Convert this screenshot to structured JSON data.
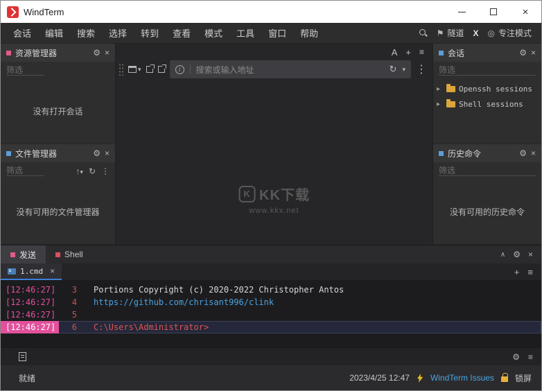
{
  "window": {
    "title": "WindTerm"
  },
  "menubar": {
    "items": [
      "会话",
      "编辑",
      "搜索",
      "选择",
      "转到",
      "查看",
      "模式",
      "工具",
      "窗口",
      "帮助"
    ],
    "tunnel_label": "隧道",
    "x_label": "X",
    "focus_label": "专注模式"
  },
  "panels": {
    "resource": {
      "title": "资源管理器",
      "filter": "筛选",
      "empty": "没有打开会话"
    },
    "files": {
      "title": "文件管理器",
      "filter": "筛选",
      "empty": "没有可用的文件管理器"
    },
    "sessions": {
      "title": "会话",
      "filter": "筛选",
      "items": [
        "Openssh sessions",
        "Shell sessions"
      ]
    },
    "history": {
      "title": "历史命令",
      "filter": "筛选",
      "empty": "没有可用的历史命令"
    }
  },
  "addressbar": {
    "placeholder": "搜索或输入地址"
  },
  "watermark": {
    "logo": "K",
    "title": "KK下载",
    "url": "www.kkx.net"
  },
  "terminal": {
    "tabs": [
      {
        "label": "发送",
        "active": true
      },
      {
        "label": "Shell",
        "active": false
      }
    ],
    "file_tab": "1.cmd",
    "lines": [
      {
        "time": "[12:46:27]",
        "num": "3",
        "text": "Portions Copyright (c) 2020-2022 Christopher Antos",
        "type": "plain",
        "current": false
      },
      {
        "time": "[12:46:27]",
        "num": "4",
        "text": "https://github.com/chrisant996/clink",
        "type": "link",
        "current": false
      },
      {
        "time": "[12:46:27]",
        "num": "5",
        "text": "",
        "type": "plain",
        "current": false
      },
      {
        "time": "[12:46:27]",
        "num": "6",
        "text": "C:\\Users\\Administrator>",
        "type": "prompt",
        "current": true
      }
    ]
  },
  "statusbar": {
    "ready": "就绪",
    "datetime": "2023/4/25 12:47",
    "issues": "WindTerm Issues",
    "lock": "锁屏"
  },
  "icons": {
    "gear": "⚙",
    "close": "×",
    "caret_down": "▾",
    "refresh": "↻",
    "more": "⋮",
    "expand": "▸",
    "collapse": "∧",
    "plus": "+",
    "menu": "≡",
    "flag": "⚑",
    "focus": "◎",
    "up": "↑",
    "font": "A",
    "info": "i"
  },
  "colors": {
    "accent_pink": "#e2519b",
    "link_blue": "#4aa3df",
    "prompt_red": "#e05252",
    "line_number_red": "#c75450",
    "folder_yellow": "#dda63a",
    "titlebar_logo_red": "#e03234"
  }
}
